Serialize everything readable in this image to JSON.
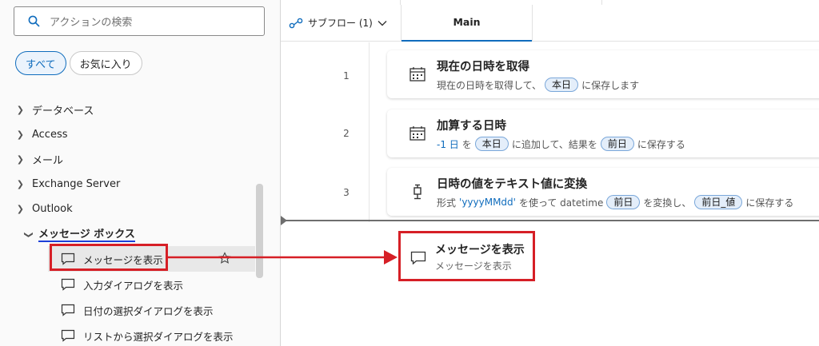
{
  "search": {
    "placeholder": "アクションの検索",
    "icon": "search-icon"
  },
  "filters": {
    "all": "すべて",
    "favorites": "お気に入り"
  },
  "tree": {
    "groups": [
      "データベース",
      "Access",
      "メール",
      "Exchange Server",
      "Outlook"
    ],
    "open_group": "メッセージ ボックス",
    "items": [
      "メッセージを表示",
      "入力ダイアログを表示",
      "日付の選択ダイアログを表示",
      "リストから選択ダイアログを表示"
    ],
    "selected_index": 0
  },
  "tabs": {
    "subflow": "サブフロー (1)",
    "main": "Main"
  },
  "actions": [
    {
      "num": "1",
      "icon": "calendar-icon",
      "title": "現在の日時を取得",
      "desc": [
        "現在の日時を取得して、",
        "に保存します"
      ],
      "tokens": [
        "本日"
      ]
    },
    {
      "num": "2",
      "icon": "calendar-icon",
      "title": "加算する日時",
      "var": "-1 日",
      "desc": [
        "を",
        "に追加して、結果を",
        "に保存する"
      ],
      "tokens": [
        "本日",
        "前日"
      ]
    },
    {
      "num": "3",
      "icon": "convert-icon",
      "title": "日時の値をテキスト値に変換",
      "desc": [
        "形式",
        "を使って datetime",
        "を変換し、",
        "に保存する"
      ],
      "var": "'yyyyMMdd'",
      "tokens": [
        "前日",
        "前日_値"
      ]
    }
  ],
  "dragged": {
    "title": "メッセージを表示",
    "desc": "メッセージを表示"
  },
  "colors": {
    "accent": "#0f6cbd",
    "highlight": "#d61f26"
  }
}
